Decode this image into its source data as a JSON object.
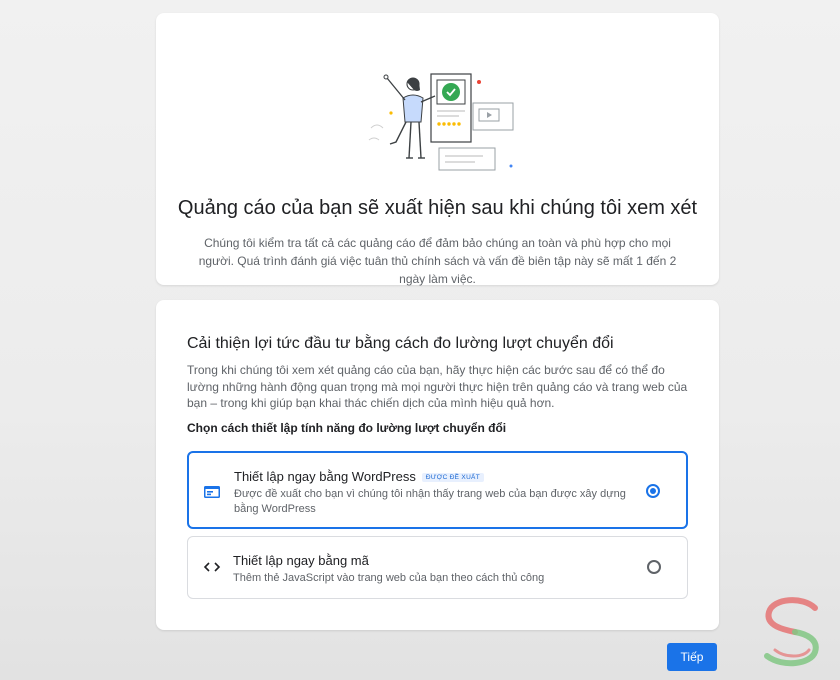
{
  "review": {
    "title": "Quảng cáo của bạn sẽ xuất hiện sau khi chúng tôi xem xét",
    "description": "Chúng tôi kiểm tra tất cả các quảng cáo để đảm bảo chúng an toàn và phù hợp cho mọi người. Quá trình đánh giá việc tuân thủ chính sách và vấn đề biên tập này sẽ mất 1 đến 2 ngày làm việc."
  },
  "conversion": {
    "title": "Cải thiện lợi tức đầu tư bằng cách đo lường lượt chuyển đổi",
    "description": "Trong khi chúng tôi xem xét quảng cáo của bạn, hãy thực hiện các bước sau để có thể đo lường những hành động quan trọng mà mọi người thực hiện trên quảng cáo và trang web của bạn – trong khi giúp bạn khai thác chiến dịch của mình hiệu quả hơn.",
    "subtitle": "Chọn cách thiết lập tính năng đo lường lượt chuyển đổi",
    "options": [
      {
        "title": "Thiết lập ngay bằng WordPress",
        "badge": "ĐƯỢC ĐỀ XUẤT",
        "description": "Được đề xuất cho bạn vì chúng tôi nhận thấy trang web của bạn được xây dựng bằng WordPress",
        "icon": "browser-window-icon",
        "selected": true
      },
      {
        "title": "Thiết lập ngay bằng mã",
        "description": "Thêm thẻ JavaScript vào trang web của bạn theo cách thủ công",
        "icon": "code-icon",
        "selected": false
      }
    ]
  },
  "actions": {
    "next_label": "Tiếp"
  },
  "colors": {
    "accent": "#1a73e8",
    "success": "#34a853",
    "text": "#202124",
    "muted": "#5f6368"
  }
}
